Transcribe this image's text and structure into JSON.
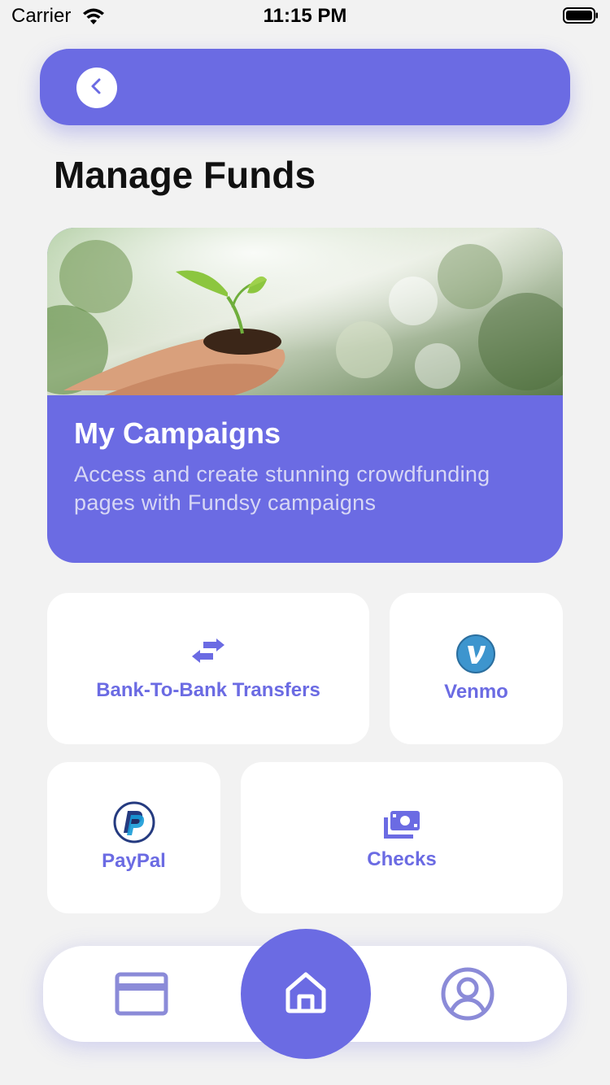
{
  "status_bar": {
    "carrier": "Carrier",
    "time": "11:15 PM",
    "wifi_icon": "wifi-icon",
    "battery_icon": "battery-icon"
  },
  "header": {
    "back_icon": "chevron-left-icon"
  },
  "page": {
    "title": "Manage Funds"
  },
  "campaign_card": {
    "title": "My Campaigns",
    "description": "Access and create stunning crowdfunding pages with Fundsy campaigns",
    "image": "hands-holding-seedling-photo"
  },
  "options": {
    "bank": {
      "label": "Bank-To-Bank Transfers",
      "icon": "transfer-arrows-icon"
    },
    "venmo": {
      "label": "Venmo",
      "icon": "venmo-logo-icon"
    },
    "paypal": {
      "label": "PayPal",
      "icon": "paypal-logo-icon"
    },
    "checks": {
      "label": "Checks",
      "icon": "cash-bills-icon"
    }
  },
  "bottom_nav": {
    "items": [
      {
        "icon": "credit-card-icon"
      },
      {
        "icon": "home-icon",
        "active": true
      },
      {
        "icon": "user-circle-icon"
      }
    ]
  },
  "colors": {
    "accent": "#6b6be3",
    "background": "#f2f2f2",
    "card": "#ffffff",
    "title_text": "#111111"
  }
}
